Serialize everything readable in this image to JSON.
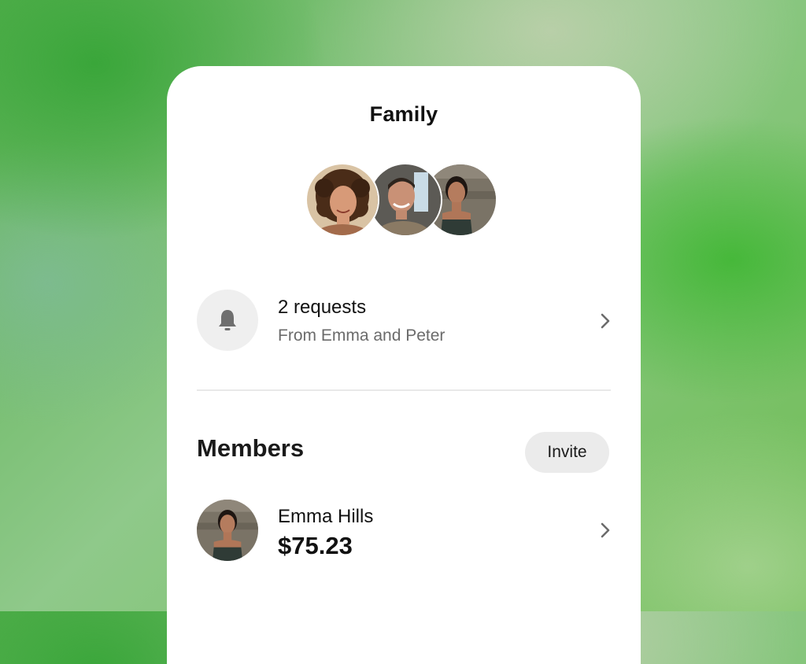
{
  "header": {
    "title": "Family"
  },
  "group_avatars": [
    {
      "icon": "person-avatar-curly-hair"
    },
    {
      "icon": "person-avatar-man"
    },
    {
      "icon": "person-avatar-woman"
    }
  ],
  "requests": {
    "icon": "bell-icon",
    "title": "2 requests",
    "subtitle": "From Emma and Peter"
  },
  "members_section": {
    "title": "Members",
    "invite_label": "Invite",
    "members": [
      {
        "name": "Emma Hills",
        "amount": "$75.23",
        "icon": "person-avatar-woman"
      }
    ]
  },
  "colors": {
    "background_green": "#4cb43c",
    "card": "#ffffff",
    "muted_text": "#6b6b6b",
    "pill": "#ebebeb"
  }
}
